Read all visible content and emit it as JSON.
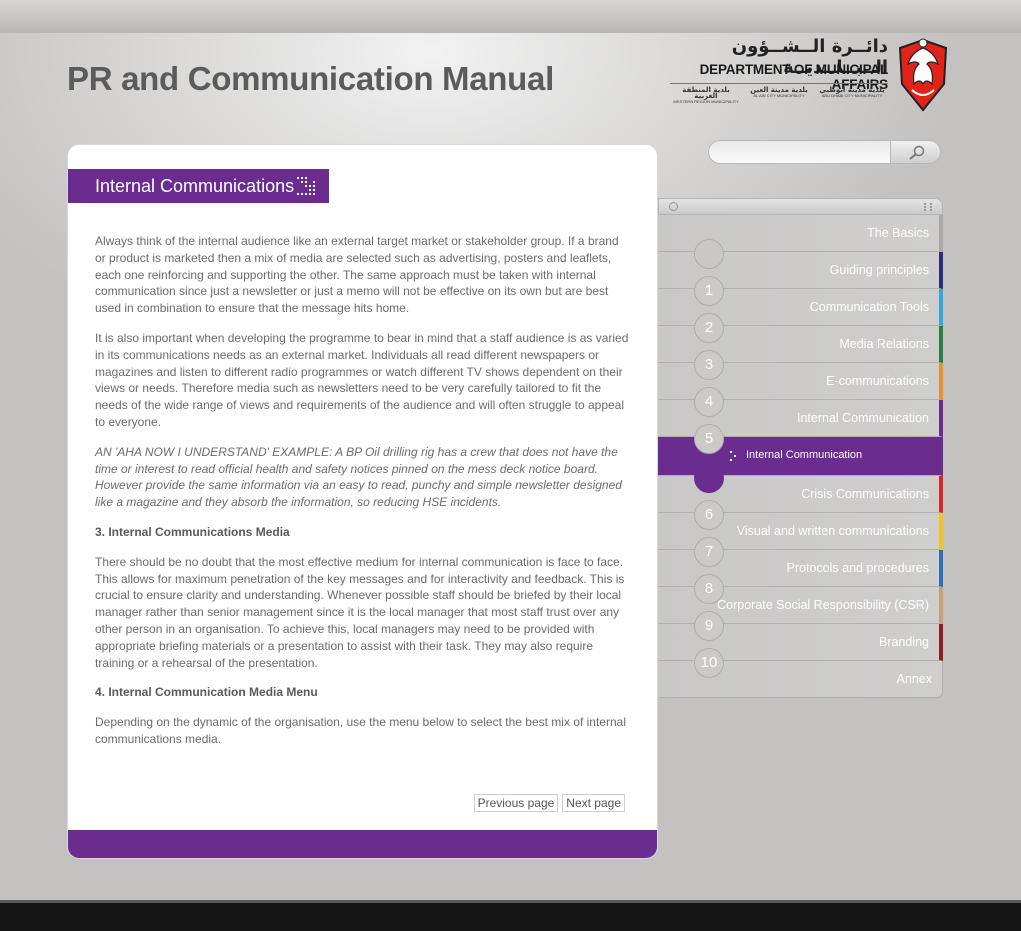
{
  "app": {
    "title": "PR and Communication Manual"
  },
  "logo": {
    "arabic_name": "دائــرة الــشــؤون الــبــلــديــة",
    "english_name": "DEPARTMENT OF MUNICIPAL AFFAIRS",
    "subs": [
      {
        "ar": "بلدية المنطقة الغربية",
        "en": "WESTERN REGION MUNICIPALITY"
      },
      {
        "ar": "بلدية مدينة العين",
        "en": "AL AIN CITY MUNICIPALITY"
      },
      {
        "ar": "بلدية مدينة أبوظبي",
        "en": "ABU DHABI CITY MUNICIPALITY"
      }
    ]
  },
  "section": {
    "title": "Internal Communications"
  },
  "content": {
    "p1": "Always think of the internal audience like an external target market or stakeholder group. If a brand or product is marketed then a mix of media are selected such as advertising, posters and leaflets, each one reinforcing and supporting the other. The same approach must be taken with internal communication since just a newsletter or just a memo will not be effective on its own but are best used in combination to ensure that the message hits home.",
    "p2": "It is also important when developing the programme to bear in mind that a staff audience is as varied in its communications needs as an external market. Individuals all read different newspapers or magazines and listen to different radio programmes or watch different TV shows dependent on their views or needs. Therefore media such as newsletters need to be very carefully tailored to fit the needs of the wide range of views and requirements of the audience and will often struggle to appeal to everyone.",
    "example": "AN 'AHA NOW I UNDERSTAND' EXAMPLE: A BP Oil drilling rig has a crew that does not have the time or interest to read official health and safety notices pinned on the mess deck notice board. However provide the same information via an easy to read, punchy and simple newsletter designed like a magazine and they absorb the information, so reducing HSE incidents.",
    "h3": "3. Internal Communications Media",
    "p3": "There should be no doubt that the most effective medium for internal communication is face to face. This allows for maximum penetration of the key messages and for interactivity and feedback. This is crucial to ensure clarity and understanding. Whenever possible staff should be briefed by their local manager rather than senior management since it is the local manager that most staff trust over any other person in an organisation. To achieve this, local managers may need to be provided with appropriate briefing materials or a presentation to assist with their task. They may also require training or a rehearsal of the presentation.",
    "h4": "4. Internal Communication Media Menu",
    "p4": "Depending on the dynamic of the organisation, use the menu below to select the best mix of internal communications media."
  },
  "pager": {
    "previous": "Previous page",
    "next": "Next page"
  },
  "search": {
    "value": "",
    "placeholder": ""
  },
  "menu": {
    "items": [
      {
        "label": "The Basics",
        "color": "#a9a9a9"
      },
      {
        "label": "Guiding principles",
        "color": "#2b2c7c"
      },
      {
        "label": "Communication Tools",
        "color": "#35a8d6"
      },
      {
        "label": "Media Relations",
        "color": "#2f7d3a"
      },
      {
        "label": "E-communications",
        "color": "#e88f34"
      },
      {
        "label": "Internal Communication",
        "color": "#6a2c8e"
      },
      {
        "label": "Internal Communication",
        "color": "#6a2c8e",
        "active": true
      },
      {
        "label": "Crisis Communications",
        "color": "#d9262b"
      },
      {
        "label": "Visual and written communications",
        "color": "#f0c419"
      },
      {
        "label": "Protocols and procedures",
        "color": "#2d6db5"
      },
      {
        "label": "Corporate Social Responsibility (CSR)",
        "color": "#c8a076"
      },
      {
        "label": "Branding",
        "color": "#8f1d22"
      },
      {
        "label": "Annex",
        "color": "#b0b0b0"
      }
    ],
    "numbers": [
      "1",
      "2",
      "3",
      "4",
      "5",
      "6",
      "7",
      "8",
      "9",
      "10"
    ]
  },
  "colors": {
    "accent": "#6a2c8e",
    "title": "#5b5b5b"
  }
}
